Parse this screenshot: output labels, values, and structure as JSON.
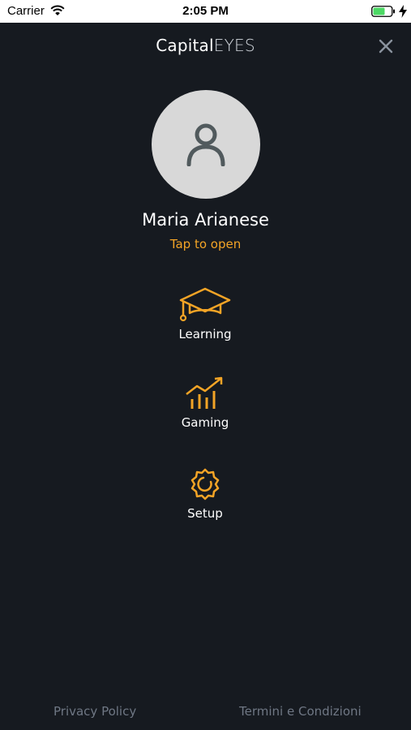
{
  "status_bar": {
    "carrier": "Carrier",
    "time": "2:05 PM"
  },
  "header": {
    "title_part1": "Capital",
    "title_part2": "EYES",
    "close_icon": "close-icon"
  },
  "profile": {
    "name": "Maria Arianese",
    "hint": "Tap to open",
    "avatar_icon": "user-icon"
  },
  "menu": {
    "items": [
      {
        "label": "Learning",
        "icon": "graduation-cap-icon"
      },
      {
        "label": "Gaming",
        "icon": "chart-growth-icon"
      },
      {
        "label": "Setup",
        "icon": "gear-icon"
      }
    ]
  },
  "footer": {
    "privacy": "Privacy Policy",
    "terms": "Termini e Condizioni"
  },
  "colors": {
    "background": "#161a20",
    "accent": "#f3a426",
    "muted": "#6f7784",
    "avatar_bg": "#d8d8d8"
  }
}
